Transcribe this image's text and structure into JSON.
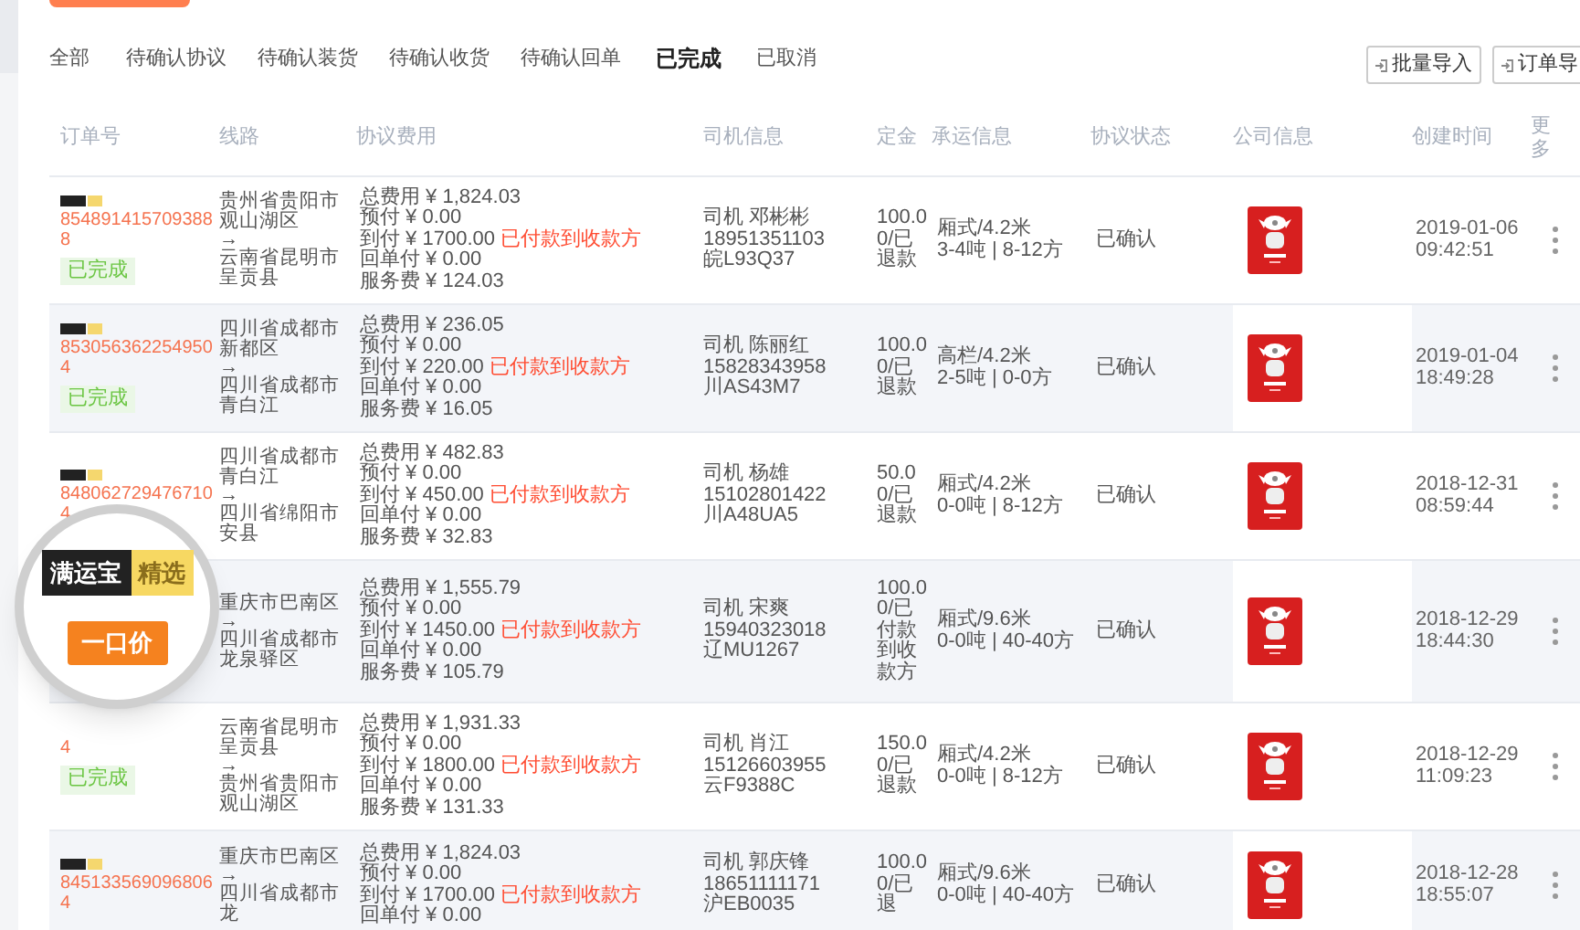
{
  "tabs": [
    {
      "label": "全部",
      "selected": false
    },
    {
      "label": "待确认协议",
      "selected": false
    },
    {
      "label": "待确认装货",
      "selected": false
    },
    {
      "label": "待确认收货",
      "selected": false
    },
    {
      "label": "待确认回单",
      "selected": false
    },
    {
      "label": "已完成",
      "selected": true
    },
    {
      "label": "已取消",
      "selected": false
    }
  ],
  "toolbar": {
    "buttons": [
      "批量导入",
      "订单导"
    ]
  },
  "table": {
    "columns": [
      "订单号",
      "线路",
      "协议费用",
      "司机信息",
      "定金",
      "承运信息",
      "协议状态",
      "公司信息",
      "创建时间",
      "更多"
    ],
    "rows": [
      {
        "badge": true,
        "order_no": "8548914157093888",
        "status": "已完成",
        "route_from": "贵州省贵阳市观山湖区",
        "arrow": "→",
        "route_to": "云南省昆明市呈贡县",
        "fees": [
          {
            "label": "总费用 ¥ 1,824.03"
          },
          {
            "label": "预付 ¥ 0.00"
          },
          {
            "label": "到付 ¥ 1700.00",
            "note": "已付款到收款方"
          },
          {
            "label": "回单付 ¥ 0.00"
          },
          {
            "label": "服务费 ¥ 124.03"
          }
        ],
        "driver": [
          "司机 邓彬彬",
          "18951351103",
          "皖L93Q37"
        ],
        "deposit": "100.00/已退款",
        "carrier": [
          "厢式/4.2米",
          "3-4吨 | 8-12方"
        ],
        "agreement": "已确认",
        "created": [
          "2019-01-06",
          "09:42:51"
        ]
      },
      {
        "badge": true,
        "order_no": "8530563622549504",
        "status": "已完成",
        "route_from": "四川省成都市新都区",
        "arrow": "→",
        "route_to": "四川省成都市青白江",
        "fees": [
          {
            "label": "总费用 ¥ 236.05"
          },
          {
            "label": "预付 ¥ 0.00"
          },
          {
            "label": "到付 ¥ 220.00",
            "note": "已付款到收款方"
          },
          {
            "label": "回单付 ¥ 0.00"
          },
          {
            "label": "服务费 ¥ 16.05"
          }
        ],
        "driver": [
          "司机 陈丽红",
          "15828343958",
          "川AS43M7"
        ],
        "deposit": "100.00/已退款",
        "carrier": [
          "高栏/4.2米",
          "2-5吨 | 0-0方"
        ],
        "agreement": "已确认",
        "created": [
          "2019-01-04",
          "18:49:28"
        ]
      },
      {
        "badge": true,
        "order_no": "8480627294767104",
        "route_from": "四川省成都市青白江",
        "arrow": "→",
        "route_to": "四川省绵阳市安县",
        "fees": [
          {
            "label": "总费用 ¥ 482.83"
          },
          {
            "label": "预付 ¥ 0.00"
          },
          {
            "label": "到付 ¥ 450.00",
            "note": "已付款到收款方"
          },
          {
            "label": "回单付 ¥ 0.00"
          },
          {
            "label": "服务费 ¥ 32.83"
          }
        ],
        "driver": [
          "司机 杨雄",
          "15102801422",
          "川A48UA5"
        ],
        "deposit": "50.00/已退款",
        "carrier": [
          "厢式/4.2米",
          "0-0吨 | 8-12方"
        ],
        "agreement": "已确认",
        "created": [
          "2018-12-31",
          "08:59:44"
        ]
      },
      {
        "route_from": "重庆市巴南区",
        "arrow": "→",
        "route_to": "四川省成都市龙泉驿区",
        "fees": [
          {
            "label": "总费用 ¥ 1,555.79"
          },
          {
            "label": "预付 ¥ 0.00"
          },
          {
            "label": "到付 ¥ 1450.00",
            "note": "已付款到收款方"
          },
          {
            "label": "回单付 ¥ 0.00"
          },
          {
            "label": "服务费 ¥ 105.79"
          }
        ],
        "driver": [
          "司机 宋爽",
          "15940323018",
          "辽MU1267"
        ],
        "deposit": "100.00/已付款到收款方",
        "carrier": [
          "厢式/9.6米",
          "0-0吨 | 40-40方"
        ],
        "agreement": "已确认",
        "created": [
          "2018-12-29",
          "18:44:30"
        ]
      },
      {
        "order_no": "4",
        "status": "已完成",
        "route_from": "云南省昆明市呈贡县",
        "arrow": "→",
        "route_to": "贵州省贵阳市观山湖区",
        "fees": [
          {
            "label": "总费用 ¥ 1,931.33"
          },
          {
            "label": "预付 ¥ 0.00"
          },
          {
            "label": "到付 ¥ 1800.00",
            "note": "已付款到收款方"
          },
          {
            "label": "回单付 ¥ 0.00"
          },
          {
            "label": "服务费 ¥ 131.33"
          }
        ],
        "driver": [
          "司机 肖江",
          "15126603955",
          "云F9388C"
        ],
        "deposit": "150.00/已退款",
        "carrier": [
          "厢式/4.2米",
          "0-0吨 | 8-12方"
        ],
        "agreement": "已确认",
        "created": [
          "2018-12-29",
          "11:09:23"
        ]
      },
      {
        "badge": true,
        "order_no": "8451335690968064",
        "route_from": "重庆市巴南区",
        "arrow": "→",
        "route_to": "四川省成都市龙",
        "fees": [
          {
            "label": "总费用 ¥ 1,824.03"
          },
          {
            "label": "预付 ¥ 0.00"
          },
          {
            "label": "到付 ¥ 1700.00",
            "note": "已付款到收款方"
          },
          {
            "label": "回单付 ¥ 0.00"
          }
        ],
        "driver": [
          "司机 郭庆锋",
          "18651111171",
          "沪EB0035"
        ],
        "deposit": "100.00/已退",
        "carrier": [
          "厢式/9.6米",
          "0-0吨 | 40-40方"
        ],
        "agreement": "已确认",
        "created": [
          "2018-12-28",
          "18:55:07"
        ]
      }
    ]
  },
  "magnifier": {
    "tags": [
      "满运宝",
      "精选"
    ],
    "price_tag": "一口价"
  }
}
